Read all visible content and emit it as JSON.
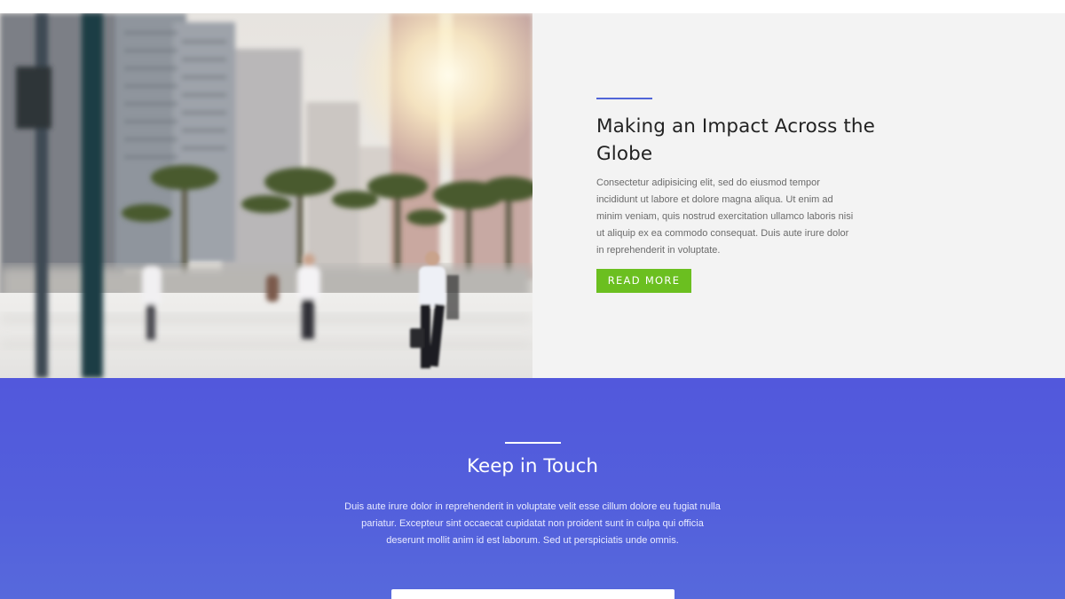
{
  "feature": {
    "title": "Making an Impact Across the Globe",
    "body": "Consectetur adipisicing elit, sed do eiusmod tempor incididunt ut labore et dolore magna aliqua. Ut enim ad minim veniam, quis nostrud exercitation ullamco laboris nisi ut aliquip ex ea commodo consequat. Duis aute irure dolor in reprehenderit in voluptate.",
    "button_label": "READ MORE",
    "button_color": "#6bbf20",
    "accent_color": "#5065d8"
  },
  "touch": {
    "title": "Keep in Touch",
    "body": "Duis aute irure dolor in reprehenderit in voluptate velit esse cillum dolore eu fugiat nulla pariatur. Excepteur sint occaecat cupidatat non proident sunt in culpa qui officia deserunt mollit anim id est laborum. Sed ut perspiciatis unde omnis.",
    "background_color": "#5360dc",
    "email_placeholder": ""
  }
}
